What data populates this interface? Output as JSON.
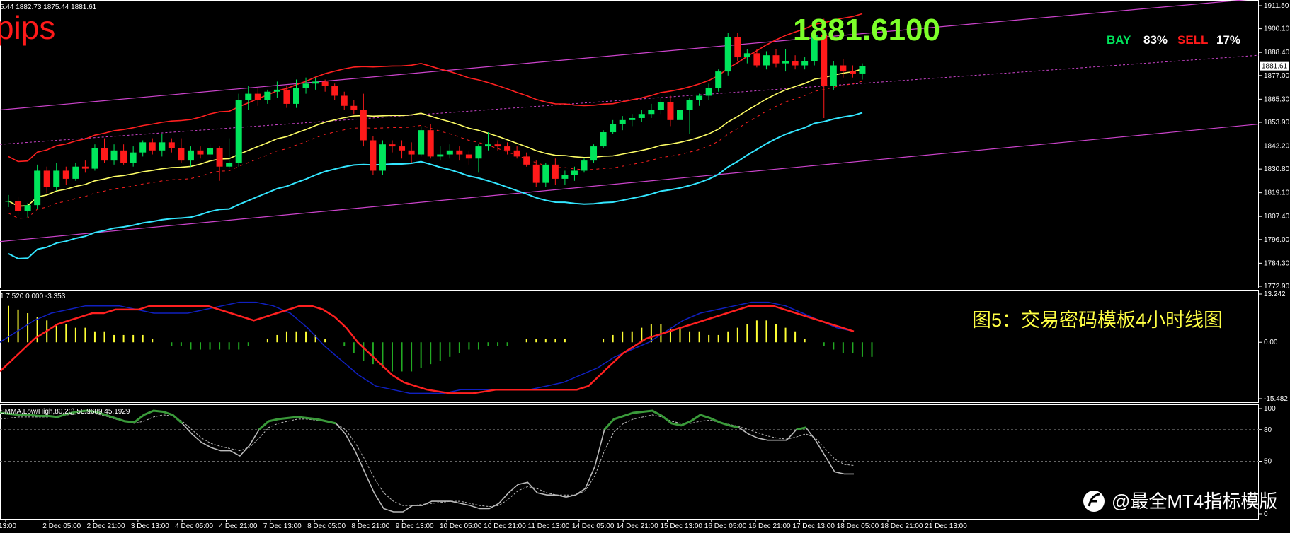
{
  "header": {
    "ohlc_text": "5.44 1882.73 1875.44 1881.61",
    "pips_label": "pips",
    "big_price": "1881.6100",
    "bay_label": "BAY",
    "bay_pct": "83%",
    "sell_label": "SELL",
    "sell_pct": "17%",
    "current_price_tag": "1881.61"
  },
  "caption": "图5：交易密码模板4小时线图",
  "watermark": "@最全MT4指标模版",
  "macd_label": "1 7.520 0.000 -3.353",
  "stoch_label": "SMMA,Low/High,80,20) 50.9689 45.1929",
  "colors": {
    "bull": "#00e65c",
    "bear": "#ff1a1a",
    "ma_red": "#ff2020",
    "ma_yellow": "#ffff66",
    "ma_cyan": "#33e6ff",
    "channel": "#cc44cc",
    "macd_signal": "#ff2020",
    "macd_main": "#1020c0",
    "hist_pos": "#ffff33",
    "hist_neg": "#22aa22",
    "stoch_main": "#3a9a3a",
    "stoch_signal": "#bbbbbb",
    "big_price": "#7dff2a",
    "caption": "#ffff44"
  },
  "chart_data": {
    "type": "candlestick",
    "price_axis": [
      "1911.50",
      "1900.10",
      "1888.40",
      "1877.00",
      "1865.30",
      "1853.90",
      "1842.20",
      "1830.80",
      "1819.10",
      "1807.40",
      "1796.00",
      "1784.30",
      "1772.90"
    ],
    "ylim": [
      1772.9,
      1911.5
    ],
    "time_labels": [
      "13:00",
      "2 Dec 05:00",
      "2 Dec 21:00",
      "3 Dec 13:00",
      "4 Dec 05:00",
      "4 Dec 21:00",
      "7 Dec 13:00",
      "8 Dec 05:00",
      "8 Dec 21:00",
      "9 Dec 13:00",
      "10 Dec 05:00",
      "10 Dec 21:00",
      "11 Dec 13:00",
      "14 Dec 05:00",
      "14 Dec 21:00",
      "15 Dec 13:00",
      "16 Dec 05:00",
      "16 Dec 21:00",
      "17 Dec 13:00",
      "18 Dec 05:00",
      "18 Dec 21:00",
      "21 Dec 13:00"
    ],
    "candles": [
      {
        "o": 1815,
        "h": 1818,
        "l": 1812,
        "c": 1815
      },
      {
        "o": 1815,
        "h": 1817,
        "l": 1808,
        "c": 1810
      },
      {
        "o": 1810,
        "h": 1814,
        "l": 1807,
        "c": 1813
      },
      {
        "o": 1813,
        "h": 1833,
        "l": 1811,
        "c": 1830
      },
      {
        "o": 1830,
        "h": 1832,
        "l": 1819,
        "c": 1822
      },
      {
        "o": 1822,
        "h": 1834,
        "l": 1820,
        "c": 1830
      },
      {
        "o": 1830,
        "h": 1832,
        "l": 1823,
        "c": 1826
      },
      {
        "o": 1826,
        "h": 1834,
        "l": 1825,
        "c": 1832
      },
      {
        "o": 1832,
        "h": 1835,
        "l": 1829,
        "c": 1831
      },
      {
        "o": 1831,
        "h": 1843,
        "l": 1830,
        "c": 1841
      },
      {
        "o": 1841,
        "h": 1846,
        "l": 1834,
        "c": 1835
      },
      {
        "o": 1835,
        "h": 1843,
        "l": 1833,
        "c": 1840
      },
      {
        "o": 1840,
        "h": 1843,
        "l": 1833,
        "c": 1834
      },
      {
        "o": 1834,
        "h": 1842,
        "l": 1832,
        "c": 1839
      },
      {
        "o": 1839,
        "h": 1845,
        "l": 1837,
        "c": 1844
      },
      {
        "o": 1844,
        "h": 1846,
        "l": 1838,
        "c": 1840
      },
      {
        "o": 1840,
        "h": 1848,
        "l": 1837,
        "c": 1844
      },
      {
        "o": 1844,
        "h": 1846,
        "l": 1839,
        "c": 1841
      },
      {
        "o": 1841,
        "h": 1846,
        "l": 1834,
        "c": 1835
      },
      {
        "o": 1835,
        "h": 1842,
        "l": 1832,
        "c": 1840
      },
      {
        "o": 1840,
        "h": 1842,
        "l": 1836,
        "c": 1838
      },
      {
        "o": 1838,
        "h": 1843,
        "l": 1836,
        "c": 1841
      },
      {
        "o": 1841,
        "h": 1842,
        "l": 1825,
        "c": 1832
      },
      {
        "o": 1832,
        "h": 1846,
        "l": 1831,
        "c": 1834
      },
      {
        "o": 1834,
        "h": 1868,
        "l": 1832,
        "c": 1865
      },
      {
        "o": 1865,
        "h": 1872,
        "l": 1860,
        "c": 1868
      },
      {
        "o": 1868,
        "h": 1871,
        "l": 1862,
        "c": 1865
      },
      {
        "o": 1865,
        "h": 1870,
        "l": 1863,
        "c": 1869
      },
      {
        "o": 1869,
        "h": 1874,
        "l": 1866,
        "c": 1870
      },
      {
        "o": 1870,
        "h": 1872,
        "l": 1861,
        "c": 1863
      },
      {
        "o": 1863,
        "h": 1875,
        "l": 1861,
        "c": 1871
      },
      {
        "o": 1871,
        "h": 1876,
        "l": 1868,
        "c": 1873
      },
      {
        "o": 1873,
        "h": 1876,
        "l": 1870,
        "c": 1874
      },
      {
        "o": 1874,
        "h": 1875,
        "l": 1869,
        "c": 1872
      },
      {
        "o": 1872,
        "h": 1873,
        "l": 1865,
        "c": 1867
      },
      {
        "o": 1867,
        "h": 1869,
        "l": 1860,
        "c": 1862
      },
      {
        "o": 1862,
        "h": 1865,
        "l": 1858,
        "c": 1860
      },
      {
        "o": 1860,
        "h": 1868,
        "l": 1842,
        "c": 1845
      },
      {
        "o": 1845,
        "h": 1847,
        "l": 1828,
        "c": 1830
      },
      {
        "o": 1830,
        "h": 1845,
        "l": 1828,
        "c": 1843
      },
      {
        "o": 1843,
        "h": 1845,
        "l": 1839,
        "c": 1842
      },
      {
        "o": 1842,
        "h": 1845,
        "l": 1836,
        "c": 1840
      },
      {
        "o": 1840,
        "h": 1844,
        "l": 1834,
        "c": 1838
      },
      {
        "o": 1838,
        "h": 1852,
        "l": 1837,
        "c": 1850
      },
      {
        "o": 1850,
        "h": 1853,
        "l": 1836,
        "c": 1837
      },
      {
        "o": 1837,
        "h": 1842,
        "l": 1835,
        "c": 1838
      },
      {
        "o": 1838,
        "h": 1843,
        "l": 1836,
        "c": 1840
      },
      {
        "o": 1840,
        "h": 1842,
        "l": 1835,
        "c": 1838
      },
      {
        "o": 1838,
        "h": 1840,
        "l": 1833,
        "c": 1836
      },
      {
        "o": 1836,
        "h": 1843,
        "l": 1829,
        "c": 1842
      },
      {
        "o": 1842,
        "h": 1849,
        "l": 1840,
        "c": 1843
      },
      {
        "o": 1843,
        "h": 1845,
        "l": 1840,
        "c": 1842
      },
      {
        "o": 1842,
        "h": 1844,
        "l": 1838,
        "c": 1840
      },
      {
        "o": 1840,
        "h": 1842,
        "l": 1836,
        "c": 1837
      },
      {
        "o": 1837,
        "h": 1839,
        "l": 1832,
        "c": 1833
      },
      {
        "o": 1833,
        "h": 1835,
        "l": 1822,
        "c": 1824
      },
      {
        "o": 1824,
        "h": 1834,
        "l": 1822,
        "c": 1833
      },
      {
        "o": 1833,
        "h": 1836,
        "l": 1823,
        "c": 1826
      },
      {
        "o": 1826,
        "h": 1830,
        "l": 1823,
        "c": 1828
      },
      {
        "o": 1828,
        "h": 1832,
        "l": 1825,
        "c": 1830
      },
      {
        "o": 1830,
        "h": 1836,
        "l": 1829,
        "c": 1835
      },
      {
        "o": 1835,
        "h": 1843,
        "l": 1834,
        "c": 1842
      },
      {
        "o": 1842,
        "h": 1850,
        "l": 1841,
        "c": 1849
      },
      {
        "o": 1849,
        "h": 1855,
        "l": 1848,
        "c": 1853
      },
      {
        "o": 1853,
        "h": 1857,
        "l": 1850,
        "c": 1855
      },
      {
        "o": 1855,
        "h": 1858,
        "l": 1852,
        "c": 1856
      },
      {
        "o": 1856,
        "h": 1860,
        "l": 1854,
        "c": 1858
      },
      {
        "o": 1858,
        "h": 1863,
        "l": 1856,
        "c": 1860
      },
      {
        "o": 1860,
        "h": 1866,
        "l": 1858,
        "c": 1864
      },
      {
        "o": 1864,
        "h": 1867,
        "l": 1852,
        "c": 1855
      },
      {
        "o": 1855,
        "h": 1862,
        "l": 1853,
        "c": 1860
      },
      {
        "o": 1860,
        "h": 1866,
        "l": 1848,
        "c": 1865
      },
      {
        "o": 1865,
        "h": 1868,
        "l": 1862,
        "c": 1867
      },
      {
        "o": 1867,
        "h": 1873,
        "l": 1865,
        "c": 1871
      },
      {
        "o": 1871,
        "h": 1880,
        "l": 1869,
        "c": 1879
      },
      {
        "o": 1879,
        "h": 1898,
        "l": 1877,
        "c": 1896
      },
      {
        "o": 1896,
        "h": 1898,
        "l": 1884,
        "c": 1886
      },
      {
        "o": 1886,
        "h": 1890,
        "l": 1883,
        "c": 1888
      },
      {
        "o": 1888,
        "h": 1890,
        "l": 1881,
        "c": 1882
      },
      {
        "o": 1882,
        "h": 1889,
        "l": 1880,
        "c": 1887
      },
      {
        "o": 1887,
        "h": 1890,
        "l": 1881,
        "c": 1883
      },
      {
        "o": 1883,
        "h": 1890,
        "l": 1879,
        "c": 1884
      },
      {
        "o": 1884,
        "h": 1887,
        "l": 1880,
        "c": 1882
      },
      {
        "o": 1882,
        "h": 1886,
        "l": 1880,
        "c": 1884
      },
      {
        "o": 1884,
        "h": 1900,
        "l": 1882,
        "c": 1897
      },
      {
        "o": 1897,
        "h": 1905,
        "l": 1856,
        "c": 1872
      },
      {
        "o": 1872,
        "h": 1884,
        "l": 1870,
        "c": 1882
      },
      {
        "o": 1882,
        "h": 1885,
        "l": 1876,
        "c": 1879
      },
      {
        "o": 1879,
        "h": 1882,
        "l": 1876,
        "c": 1878
      },
      {
        "o": 1878,
        "h": 1883,
        "l": 1875,
        "c": 1881.6
      }
    ],
    "macd_axis": [
      "13.242",
      "0.00",
      "-15.482"
    ],
    "macd_ylim": [
      -15.482,
      13.242
    ],
    "macd_hist": [
      10,
      9,
      8,
      7,
      6,
      5,
      5,
      4,
      4,
      3,
      3,
      2,
      2,
      2,
      2,
      1,
      0,
      -1,
      -1,
      -2,
      -2,
      -2,
      -2,
      -2,
      -2,
      -1,
      0,
      1,
      2,
      3,
      3,
      3,
      2,
      1,
      0,
      -1,
      -3,
      -5,
      -6,
      -7,
      -8,
      -8,
      -8,
      -7,
      -6,
      -5,
      -4,
      -3,
      -2,
      -2,
      -1,
      -1,
      -1,
      0,
      1,
      1,
      1,
      1,
      1,
      0,
      0,
      0,
      1,
      2,
      3,
      3,
      4,
      5,
      5,
      4,
      4,
      3,
      3,
      2,
      2,
      3,
      4,
      5,
      6,
      6,
      5,
      4,
      3,
      1,
      0,
      -1,
      -2,
      -3,
      -3,
      -4,
      -4
    ],
    "macd_signal": [
      -8,
      -5,
      -2,
      1,
      3,
      5,
      6,
      7,
      8,
      8,
      9,
      9,
      9,
      10,
      10,
      10,
      10,
      10,
      10,
      9,
      8,
      7,
      6,
      7,
      8,
      9,
      10,
      10,
      9,
      7,
      4,
      0,
      -3,
      -6,
      -9,
      -11,
      -12,
      -13,
      -13.5,
      -14,
      -14,
      -14,
      -13.5,
      -13,
      -13,
      -13,
      -13,
      -13,
      -13,
      -13,
      -13,
      -12,
      -9,
      -6,
      -3,
      -1,
      1,
      2,
      3,
      4,
      5,
      6,
      7,
      8,
      9,
      10,
      10,
      10,
      9,
      8,
      7,
      6,
      5,
      4,
      3
    ],
    "macd_main": [
      0,
      3,
      6,
      8,
      9,
      10,
      10,
      10,
      9,
      8,
      8,
      8,
      9,
      10,
      11,
      11,
      10,
      8,
      4,
      -1,
      -5,
      -9,
      -12,
      -13,
      -14,
      -14,
      -14,
      -13,
      -13,
      -13,
      -13,
      -13,
      -12,
      -11,
      -9,
      -7,
      -4,
      -2,
      0,
      3,
      6,
      8,
      9,
      10,
      11,
      11,
      10,
      8,
      6,
      4,
      3
    ],
    "stoch_axis": [
      "100",
      "80",
      "50",
      "0"
    ],
    "stoch_levels": [
      80,
      50
    ],
    "stoch_main": [
      96,
      95,
      94,
      94,
      93,
      93,
      92,
      95,
      97,
      98,
      97,
      94,
      91,
      88,
      87,
      94,
      98,
      97,
      94,
      86,
      76,
      68,
      63,
      60,
      60,
      55,
      65,
      80,
      88,
      90,
      91,
      92,
      91,
      90,
      88,
      86,
      76,
      60,
      40,
      20,
      5,
      2,
      2,
      8,
      8,
      12,
      12,
      12,
      10,
      8,
      5,
      5,
      10,
      20,
      28,
      30,
      20,
      18,
      18,
      16,
      18,
      24,
      45,
      80,
      90,
      93,
      96,
      97,
      98,
      93,
      86,
      84,
      88,
      94,
      91,
      87,
      84,
      82,
      76,
      72,
      70,
      70,
      70,
      80,
      82,
      70,
      55,
      40,
      38,
      38
    ],
    "stoch_signal": [
      90,
      91,
      92,
      92,
      92,
      92,
      93,
      94,
      95,
      96,
      95,
      93,
      90,
      88,
      86,
      88,
      92,
      94,
      93,
      88,
      80,
      72,
      67,
      64,
      62,
      60,
      63,
      72,
      82,
      86,
      88,
      90,
      90,
      89,
      88,
      86,
      80,
      68,
      52,
      34,
      20,
      12,
      8,
      8,
      9,
      10,
      11,
      12,
      12,
      10,
      8,
      7,
      8,
      14,
      22,
      26,
      24,
      20,
      18,
      18,
      18,
      22,
      36,
      60,
      78,
      86,
      90,
      92,
      94,
      92,
      88,
      86,
      86,
      88,
      89,
      87,
      85,
      83,
      80,
      77,
      74,
      72,
      71,
      73,
      76,
      72,
      62,
      52,
      47,
      46
    ]
  }
}
